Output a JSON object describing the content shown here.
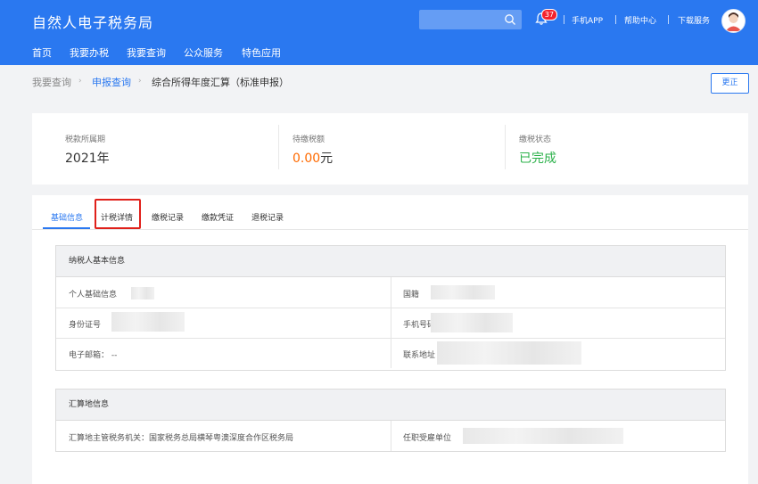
{
  "header": {
    "title": "自然人电子税务局",
    "notification_count": "37",
    "links": [
      "手机APP",
      "帮助中心",
      "下载服务"
    ],
    "nav": [
      "首页",
      "我要办税",
      "我要查询",
      "公众服务",
      "特色应用"
    ],
    "accent_color": "#2a78f0"
  },
  "breadcrumb": {
    "items": [
      "我要查询",
      "申报查询",
      "综合所得年度汇算（标准申报）"
    ],
    "correct_button": "更正"
  },
  "summary": {
    "period_label": "税款所属期",
    "period_value": "2021年",
    "amount_label": "待缴税额",
    "amount_value": "0.00",
    "amount_unit": "元",
    "status_label": "缴税状态",
    "status_value": "已完成",
    "amount_color": "#ff6a00",
    "status_color": "#2bb14a"
  },
  "tabs": [
    "基础信息",
    "计税详情",
    "缴税记录",
    "缴款凭证",
    "退税记录"
  ],
  "taxpayer_section": {
    "title": "纳税人基本信息",
    "personal_info_label": "个人基础信息",
    "nationality_label": "国籍",
    "id_label": "身份证号",
    "phone_label": "手机号码",
    "email_label": "电子邮箱：",
    "email_value": "--",
    "address_label": "联系地址"
  },
  "settlement_section": {
    "title": "汇算地信息",
    "authority_label": "汇算地主管税务机关：",
    "authority_value": "国家税务总局横琴粤澳深度合作区税务局",
    "employer_label": "任职受雇单位"
  }
}
